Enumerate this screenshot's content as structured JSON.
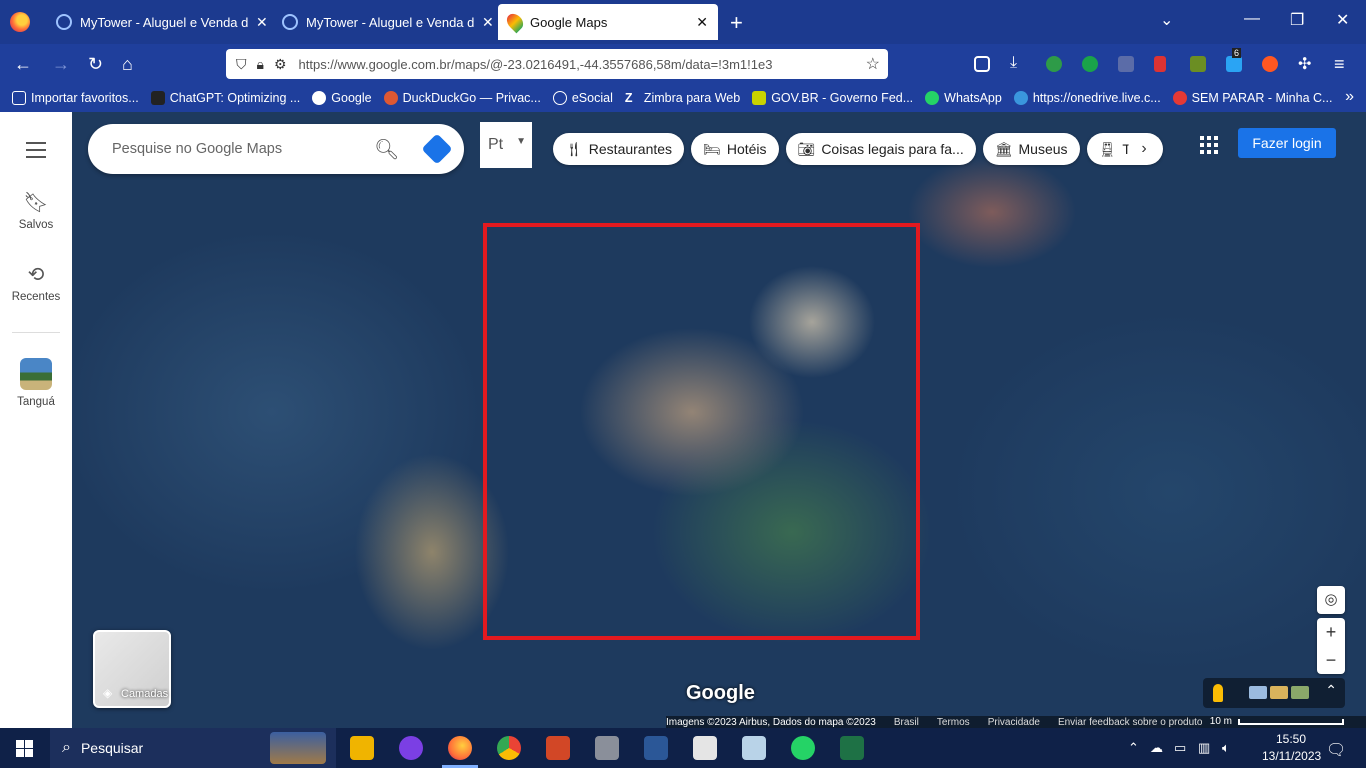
{
  "browser": {
    "tabs": [
      {
        "title": "MyTower - Aluguel e Venda de ",
        "active": false
      },
      {
        "title": "MyTower - Aluguel e Venda de ",
        "active": false
      },
      {
        "title": "Google Maps",
        "active": true
      }
    ],
    "new_tab": "+",
    "url": "https://www.google.com.br/maps/@-23.0216491,-44.3557686,58m/data=!3m1!1e3",
    "bookmarks": [
      "Importar favoritos...",
      "ChatGPT: Optimizing ...",
      "Google",
      "DuckDuckGo — Privac...",
      "eSocial",
      "Zimbra para Web",
      "GOV.BR - Governo Fed...",
      "WhatsApp",
      "https://onedrive.live.c...",
      "SEM PARAR - Minha C..."
    ],
    "extension_badge": "6"
  },
  "maps": {
    "rail": {
      "saved": "Salvos",
      "recent": "Recentes",
      "place": "Tanguá"
    },
    "search_placeholder": "Pesquise no Google Maps",
    "lang_label": "Pt",
    "chips": [
      {
        "label": "Restaurantes",
        "icon": "fork-knife-icon"
      },
      {
        "label": "Hotéis",
        "icon": "bed-icon"
      },
      {
        "label": "Coisas legais para fa...",
        "icon": "camera-icon"
      },
      {
        "label": "Museus",
        "icon": "museum-icon"
      },
      {
        "label": "Tran",
        "icon": "train-icon"
      }
    ],
    "login": "Fazer login",
    "layers": "Camadas",
    "logo": "Google",
    "attribution": "Imagens ©2023 Airbus, Dados do mapa ©2023",
    "footer_links": [
      "Brasil",
      "Termos",
      "Privacidade",
      "Enviar feedback sobre o produto"
    ],
    "scale": "10 m",
    "highlight_color": "#e3191f"
  },
  "taskbar": {
    "search": "Pesquisar",
    "time": "15:50",
    "date": "13/11/2023"
  }
}
